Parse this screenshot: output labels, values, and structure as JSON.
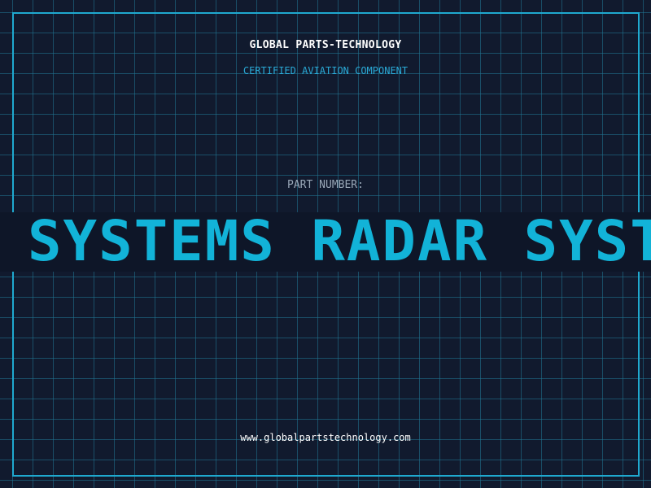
{
  "header": {
    "brand": "GLOBAL PARTS-TECHNOLOGY",
    "subtitle": "CERTIFIED AVIATION COMPONENT"
  },
  "part": {
    "label": "PART NUMBER:",
    "ticker_text": "SYSTEMS RADAR SYSTEMS"
  },
  "footer": {
    "url": "www.globalpartstechnology.com"
  },
  "colors": {
    "background": "#111a2e",
    "grid": "#1f6f8c",
    "frame": "#1fa9cf",
    "accent": "#12b3d8",
    "text": "#ffffff",
    "muted": "#9aa8b8"
  }
}
